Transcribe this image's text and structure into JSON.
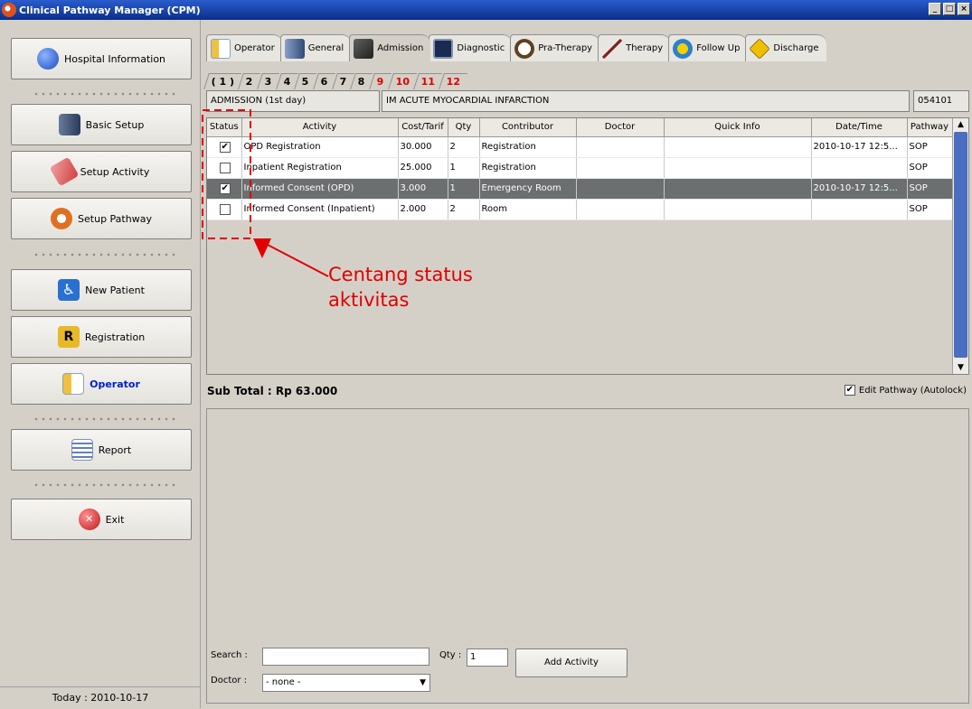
{
  "window": {
    "title": "Clinical Pathway Manager (CPM)",
    "controls": [
      "_",
      "□",
      "×"
    ]
  },
  "sidebar": {
    "items": [
      {
        "label": "Hospital Information",
        "icon": "info-icon",
        "color": "#2a60d8"
      },
      {
        "label": "Basic Setup",
        "icon": "door-icon",
        "color": "#3a4a6a"
      },
      {
        "label": "Setup Activity",
        "icon": "bandage-icon",
        "color": "#e06060"
      },
      {
        "label": "Setup Pathway",
        "icon": "lifebuoy-icon",
        "color": "#e07020"
      },
      {
        "label": "New Patient",
        "icon": "wheelchair-icon",
        "color": "#2a70d0"
      },
      {
        "label": "Registration",
        "icon": "registration-r-icon",
        "color": "#e0b020"
      },
      {
        "label": "Operator",
        "icon": "form-icon",
        "color": "#e0a020",
        "active": true
      },
      {
        "label": "Report",
        "icon": "report-icon",
        "color": "#8090b0"
      },
      {
        "label": "Exit",
        "icon": "exit-icon",
        "color": "#d03030"
      }
    ],
    "today": "Today : 2010-10-17"
  },
  "tabs": [
    {
      "label": "Operator",
      "icon": "form-icon",
      "color": "#e0a020"
    },
    {
      "label": "General",
      "icon": "building-icon",
      "color": "#406090"
    },
    {
      "label": "Admission",
      "icon": "admission-icon",
      "color": "#404040",
      "selected": true
    },
    {
      "label": "Diagnostic",
      "icon": "monitor-icon",
      "color": "#304070"
    },
    {
      "label": "Pra-Therapy",
      "icon": "clock-icon",
      "color": "#806040"
    },
    {
      "label": "Therapy",
      "icon": "injection-icon",
      "color": "#802020"
    },
    {
      "label": "Follow Up",
      "icon": "warning-icon",
      "color": "#e0c000"
    },
    {
      "label": "Discharge",
      "icon": "walk-sign-icon",
      "color": "#e0b000"
    }
  ],
  "day_tabs": [
    {
      "label": "( 1 )"
    },
    {
      "label": "2"
    },
    {
      "label": "3"
    },
    {
      "label": "4"
    },
    {
      "label": "5"
    },
    {
      "label": "6"
    },
    {
      "label": "7"
    },
    {
      "label": "8"
    },
    {
      "label": "9",
      "red": true
    },
    {
      "label": "10",
      "red": true
    },
    {
      "label": "11",
      "red": true
    },
    {
      "label": "12",
      "red": true
    }
  ],
  "info": {
    "stage": "ADMISSION  (1st day)",
    "diagnosis": "IM ACUTE MYOCARDIAL INFARCTION",
    "code": "054101"
  },
  "table": {
    "columns": [
      "Status",
      "Activity",
      "Cost/Tarif",
      "Qty",
      "Contributor",
      "Doctor",
      "Quick Info",
      "Date/Time",
      "Pathway"
    ],
    "rows": [
      {
        "status": true,
        "activity": "OPD Registration",
        "cost": "30.000",
        "qty": "2",
        "contributor": "Registration",
        "doctor": "",
        "quick_info": "",
        "datetime": "2010-10-17 12:5...",
        "pathway": "SOP"
      },
      {
        "status": false,
        "activity": "Inpatient Registration",
        "cost": "25.000",
        "qty": "1",
        "contributor": "Registration",
        "doctor": "",
        "quick_info": "",
        "datetime": "",
        "pathway": "SOP"
      },
      {
        "status": true,
        "activity": "Informed Consent (OPD)",
        "cost": "3.000",
        "qty": "1",
        "contributor": "Emergency Room",
        "doctor": "",
        "quick_info": "",
        "datetime": "2010-10-17 12:5...",
        "pathway": "SOP",
        "selected": true
      },
      {
        "status": false,
        "activity": "Informed Consent (Inpatient)",
        "cost": "2.000",
        "qty": "2",
        "contributor": "Room",
        "doctor": "",
        "quick_info": "",
        "datetime": "",
        "pathway": "SOP"
      }
    ]
  },
  "subtotal": "Sub Total : Rp 63.000",
  "edit_pathway": {
    "label": "Edit Pathway (Autolock)",
    "checked": true
  },
  "form": {
    "search_label": "Search :",
    "search_value": "",
    "qty_label": "Qty :",
    "qty_value": "1",
    "add_button": "Add Activity",
    "doctor_label": "Doctor :",
    "doctor_value": "- none -"
  },
  "annotation": {
    "text_line1": "Centang status",
    "text_line2": "aktivitas",
    "color": "#e00000"
  }
}
